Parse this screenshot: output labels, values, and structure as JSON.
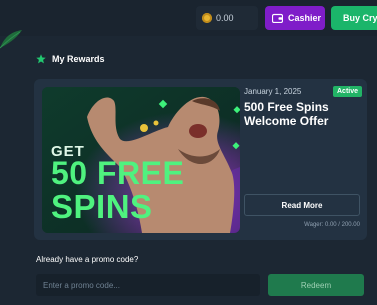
{
  "header": {
    "balance": "0.00",
    "cashier_label": "Cashier",
    "buy_label": "Buy Crypto"
  },
  "rewards": {
    "title": "My Rewards",
    "card": {
      "banner_get": "GET",
      "banner_amount": "50 FREE",
      "banner_spins": "SPINS",
      "date": "January 1, 2025",
      "status": "Active",
      "title": "500 Free Spins Welcome Offer",
      "read_more": "Read More",
      "wager": "Wager: 0.00 / 200.00"
    }
  },
  "promo": {
    "label": "Already have a promo code?",
    "placeholder": "Enter a promo code...",
    "redeem": "Redeem"
  },
  "colors": {
    "background": "#1c2733",
    "card": "#233242",
    "cashier": "#7f1dc9",
    "buy": "#1bb56a",
    "active_badge": "#22b466",
    "banner_text": "#4ff27f"
  }
}
